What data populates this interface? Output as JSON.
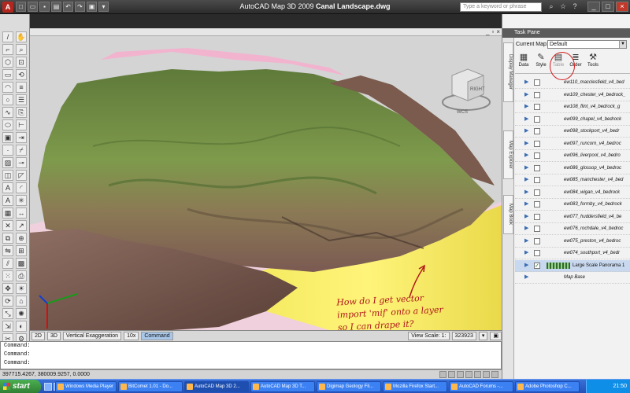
{
  "window": {
    "app_title": "AutoCAD Map 3D 2009",
    "file_title": "Canal Landscape.dwg",
    "search_placeholder": "Type a keyword or phrase"
  },
  "viewport": {
    "annotation_lines": [
      "How do I get vector",
      "import 'mif' onto a layer",
      "so I can drape it?"
    ],
    "viewcube_label": "RIGHT",
    "compass_label": "WCS"
  },
  "statusbar": {
    "view_2d": "2D",
    "view_3d": "3D",
    "vertical_exaggeration_label": "Vertical Exaggeration",
    "vertical_exaggeration_value": "10x",
    "command_tab": "Command",
    "view_scale_label": "View Scale: 1:",
    "view_scale_value": "323923"
  },
  "command_lines": [
    "Command:",
    "Command:",
    "Command:"
  ],
  "coordinates": "397715.4267, 380009.9257, 0.0000",
  "taskpane": {
    "title": "Task Pane",
    "current_map_label": "Current Map:",
    "current_map_value": "Default",
    "side_tabs": [
      "Display Manager",
      "Map Explorer",
      "Map Book"
    ],
    "toolbar": [
      {
        "label": "Data",
        "icon": "data-icon",
        "glyph": "▦"
      },
      {
        "label": "Style",
        "icon": "style-icon",
        "glyph": "✎"
      },
      {
        "label": "Table",
        "icon": "table-icon",
        "glyph": "▤"
      },
      {
        "label": "Order",
        "icon": "order-icon",
        "glyph": "≣"
      },
      {
        "label": "Tools",
        "icon": "tools-icon",
        "glyph": "⚒"
      }
    ],
    "layers": [
      "ew110_macclesfield_v4_bed",
      "ew109_chester_v4_bedrock_",
      "ew108_flint_v4_bedrock_g",
      "ew099_chapel_v4_bedrock",
      "ew098_stockport_v4_bedr",
      "ew097_runcorn_v4_bedroc",
      "ew096_liverpool_v4_bedro",
      "ew086_glossop_v4_bedroc",
      "ew085_manchester_v4_bed",
      "ew084_wigan_v4_bedrock",
      "ew083_formby_v4_bedrock",
      "ew077_huddersfield_v4_be",
      "ew076_rochdale_v4_bedroc",
      "ew075_preston_v4_bedroc",
      "ew074_southport_v4_bedr",
      "Large Scale Panorama 1",
      "Map Base"
    ]
  },
  "taskbar": {
    "start_label": "start",
    "tasks": [
      "Windows Media Player",
      "BitComet 1.01 - Do...",
      "AutoCAD Map 3D 2...",
      "AutoCAD Map 3D T...",
      "Digimap Geology Fil...",
      "Mozilla Firefox Start...",
      "AutoCAD Forums -...",
      "Adobe Photoshop C..."
    ],
    "clock": "21:50"
  },
  "colors": {
    "annotation": "#b0161b",
    "titlebar": "#2c2c2c",
    "taskbar": "#2451b8",
    "terrain_green": "#6f8f3e",
    "terrain_brown": "#7a5a4a"
  }
}
